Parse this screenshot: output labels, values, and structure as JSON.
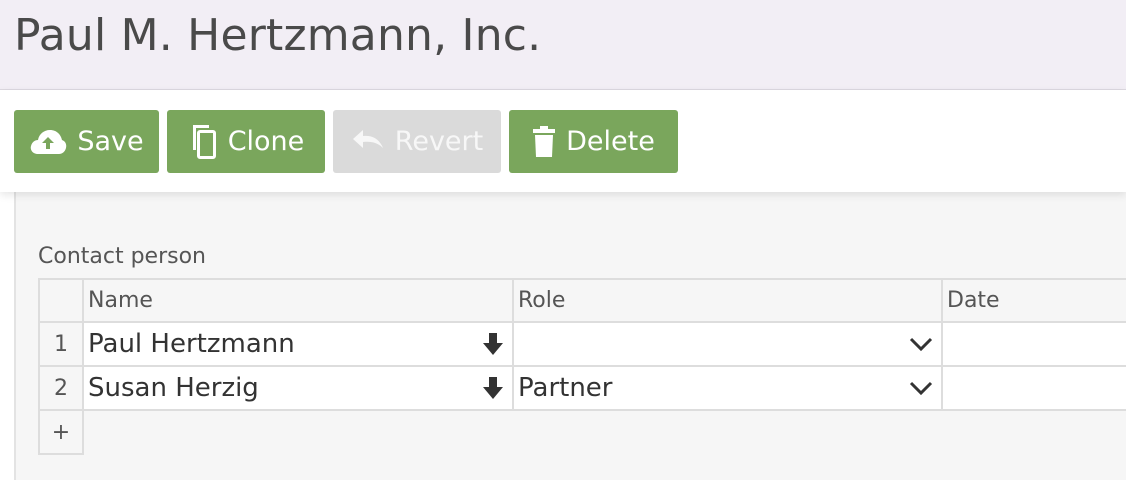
{
  "page": {
    "title": "Paul M. Hertzmann, Inc."
  },
  "toolbar": {
    "save_label": "Save",
    "clone_label": "Clone",
    "revert_label": "Revert",
    "delete_label": "Delete",
    "revert_disabled": true,
    "accent_color": "#7aa65c",
    "disabled_color": "#dadada"
  },
  "icons": {
    "save": "cloud-upload-icon",
    "clone": "copy-icon",
    "revert": "undo-icon",
    "delete": "trash-icon",
    "lookup": "arrow-down-icon",
    "dropdown": "chevron-down-icon"
  },
  "contacts": {
    "label": "Contact person",
    "columns": {
      "name": "Name",
      "role": "Role",
      "date": "Date"
    },
    "rows": [
      {
        "index": "1",
        "name": "Paul Hertzmann",
        "role": "",
        "date": ""
      },
      {
        "index": "2",
        "name": "Susan Herzig",
        "role": "Partner",
        "date": ""
      }
    ],
    "add_label": "+"
  }
}
